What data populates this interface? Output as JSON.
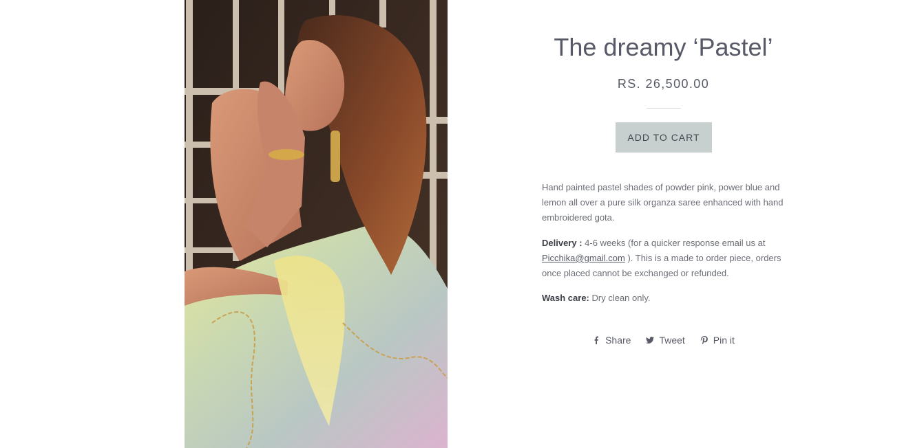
{
  "product": {
    "title": "The dreamy ‘Pastel’",
    "price": "RS. 26,500.00",
    "add_to_cart_label": "ADD TO CART",
    "image_alt": "Model wearing hand painted pastel organza saree"
  },
  "description": {
    "paragraph": "Hand painted pastel shades of powder pink, power blue and lemon all over a pure silk organza saree enhanced with hand embroidered gota.",
    "delivery_label": "Delivery :",
    "delivery_text_before": " 4-6 weeks (for a quicker response email us at ",
    "delivery_email": "Picchika@gmail.com",
    "delivery_text_after": " ). This is a made to order piece, orders once placed cannot be exchanged or refunded.",
    "wash_label": "Wash care:",
    "wash_text": " Dry clean only."
  },
  "share": {
    "facebook_label": "Share",
    "twitter_label": "Tweet",
    "pinterest_label": "Pin it",
    "icons": [
      "facebook-icon",
      "twitter-icon",
      "pinterest-icon"
    ]
  },
  "colors": {
    "button_bg": "#c8d0cf",
    "text": "#585b66"
  }
}
